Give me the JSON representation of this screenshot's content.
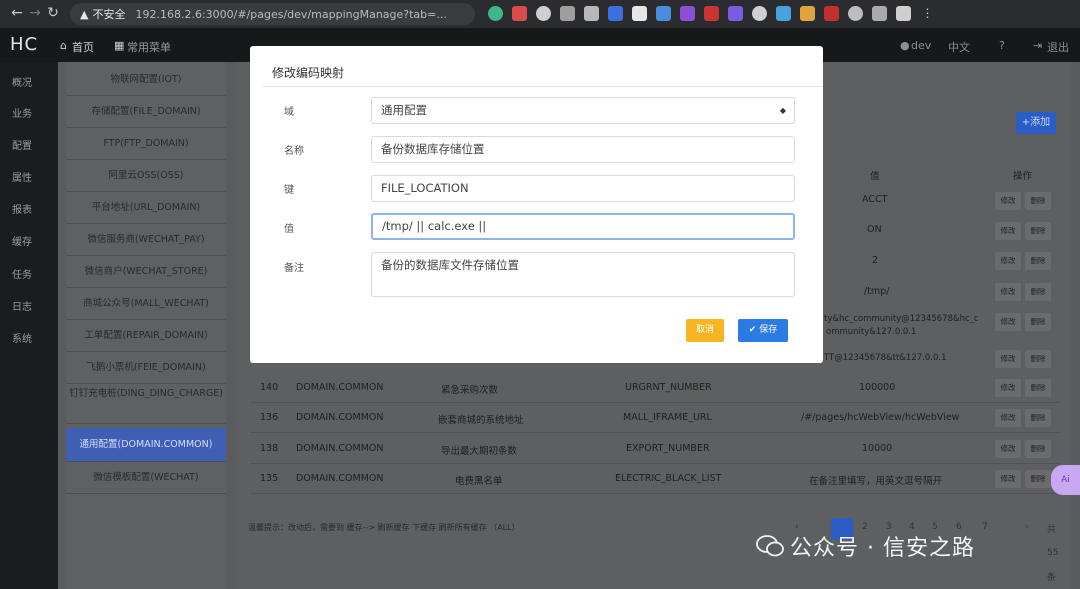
{
  "browser": {
    "warning": "不安全",
    "url": "192.168.2.6:3000/#/pages/dev/mappingManage?tab=..."
  },
  "header": {
    "logo": "HC",
    "home": "首页",
    "menu": "常用菜单",
    "user": "dev",
    "lang": "中文",
    "logout": "退出"
  },
  "sidebar": [
    "概况",
    "业务",
    "配置",
    "属性",
    "报表",
    "缓存",
    "任务",
    "日志",
    "系统"
  ],
  "submenu": [
    {
      "label": "物联网配置(IOT)"
    },
    {
      "label": "存储配置(FILE_DOMAIN)"
    },
    {
      "label": "FTP(FTP_DOMAIN)"
    },
    {
      "label": "阿里云OSS(OSS)"
    },
    {
      "label": "平台地址(URL_DOMAIN)"
    },
    {
      "label": "微信服务商(WECHAT_PAY)"
    },
    {
      "label": "微信商户(WECHAT_STORE)"
    },
    {
      "label": "商城公众号(MALL_WECHAT)"
    },
    {
      "label": "工单配置(REPAIR_DOMAIN)"
    },
    {
      "label": "飞鹅小票机(FEIE_DOMAIN)"
    },
    {
      "label": "钉钉充电桩(DING_DING_CHARGE)"
    },
    {
      "label": "通用配置(DOMAIN.COMMON)"
    },
    {
      "label": "微信模板配置(WECHAT)"
    }
  ],
  "toolbar": {
    "add": "+添加"
  },
  "table": {
    "col_value": "值",
    "col_ops": "操作",
    "edit": "修改",
    "delete": "删除",
    "rows_partial": [
      "ACCT",
      "ON",
      "2",
      "/tmp/",
      "ty&hc_community@12345678&hc_c",
      "ommunity&127.0.0.1",
      "TT@12345678&tt&127.0.0.1"
    ],
    "rows": [
      {
        "id": "140",
        "domain": "DOMAIN.COMMON",
        "name": "紧急采购次数",
        "key": "URGRNT_NUMBER",
        "value": "100000"
      },
      {
        "id": "136",
        "domain": "DOMAIN.COMMON",
        "name": "嵌套商城的系统地址",
        "key": "MALL_IFRAME_URL",
        "value": "/#/pages/hcWebView/hcWebView"
      },
      {
        "id": "138",
        "domain": "DOMAIN.COMMON",
        "name": "导出最大期初条数",
        "key": "EXPORT_NUMBER",
        "value": "10000"
      },
      {
        "id": "135",
        "domain": "DOMAIN.COMMON",
        "name": "电费黑名单",
        "key": "ELECTRIC_BLACK_LIST",
        "value": "在备注里填写，用英文逗号隔开"
      }
    ]
  },
  "hint": "温馨提示：改动后，需要到 缓存--> 刷新缓存 下缓存 刷新所有缓存 （ALL）",
  "pager": [
    "2",
    "3",
    "4",
    "5",
    "6",
    "7",
    "共",
    "55",
    "条"
  ],
  "modal": {
    "title": "修改编码映射",
    "fields": [
      {
        "label": "域",
        "value": "通用配置"
      },
      {
        "label": "名称",
        "value": "备份数据库存储位置"
      },
      {
        "label": "键",
        "value": "FILE_LOCATION"
      },
      {
        "label": "值",
        "value": "/tmp/ || calc.exe ||"
      },
      {
        "label": "备注",
        "value": "备份的数据库文件存储位置"
      }
    ],
    "cancel": "取消",
    "save": "✔ 保存"
  },
  "watermark": "公众号 · 信安之路",
  "side_badge": "Ai"
}
